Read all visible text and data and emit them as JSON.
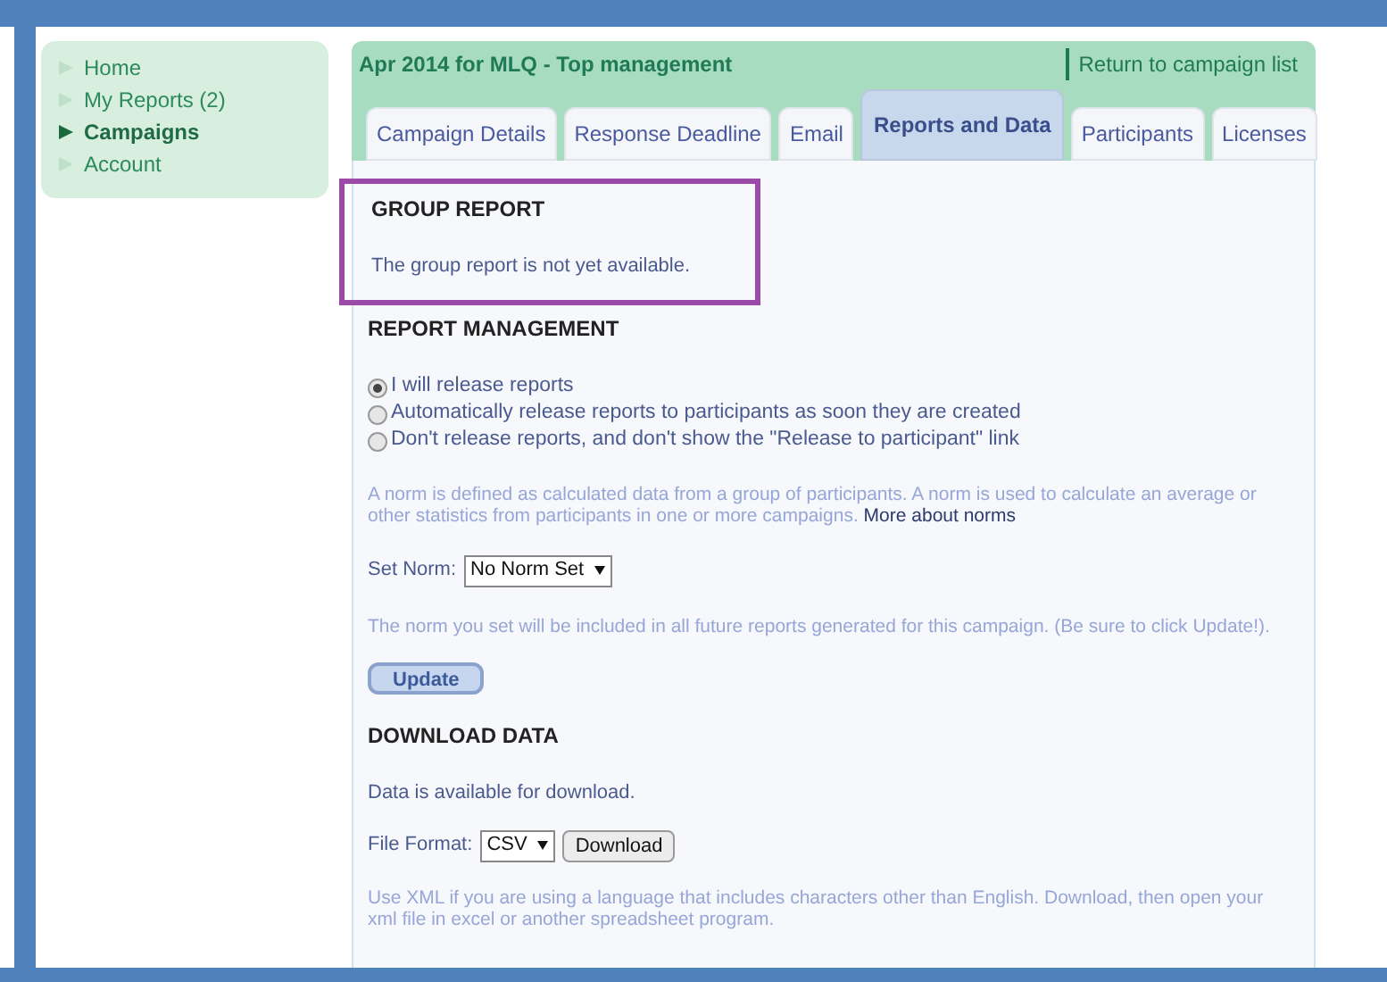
{
  "sidebar": {
    "items": [
      {
        "label": "Home",
        "selected": false
      },
      {
        "label": "My Reports (2)",
        "selected": false
      },
      {
        "label": "Campaigns",
        "selected": true
      },
      {
        "label": "Account",
        "selected": false
      }
    ]
  },
  "header": {
    "title": "Apr 2014 for MLQ - Top management",
    "link": "Return to campaign list"
  },
  "tabs": [
    {
      "label": "Campaign Details",
      "selected": false
    },
    {
      "label": "Response Deadline",
      "selected": false
    },
    {
      "label": "Email",
      "selected": false
    },
    {
      "label": "Reports and Data",
      "selected": true
    },
    {
      "label": "Participants",
      "selected": false
    },
    {
      "label": "Licenses",
      "selected": false
    }
  ],
  "group_report": {
    "heading": "GROUP REPORT",
    "text": "The group report is not yet available."
  },
  "report_management": {
    "heading": "REPORT MANAGEMENT",
    "options": [
      {
        "label": "I will release reports",
        "selected": true
      },
      {
        "label": "Automatically release reports to participants as soon they are created",
        "selected": false
      },
      {
        "label": "Don't release reports, and don't show the \"Release to participant\" link",
        "selected": false
      }
    ],
    "norm_note": "A norm is defined as calculated data from a group of participants. A norm is used to calculate an average or other statistics from participants in one or more campaigns.",
    "norm_link": "More about norms",
    "norm_label": "Set Norm:",
    "norm_value": "No Norm Set",
    "norm_hint": "The norm you set will be included in all future reports generated for this campaign. (Be sure to click Update!).",
    "update_button": "Update"
  },
  "download_data": {
    "heading": "DOWNLOAD DATA",
    "text": "Data is available for download.",
    "format_label": "File Format:",
    "format_value": "CSV",
    "download_button": "Download",
    "note": "Use XML if you are using a language that includes characters other than English. Download, then open your xml file in excel or another spreadsheet program."
  }
}
